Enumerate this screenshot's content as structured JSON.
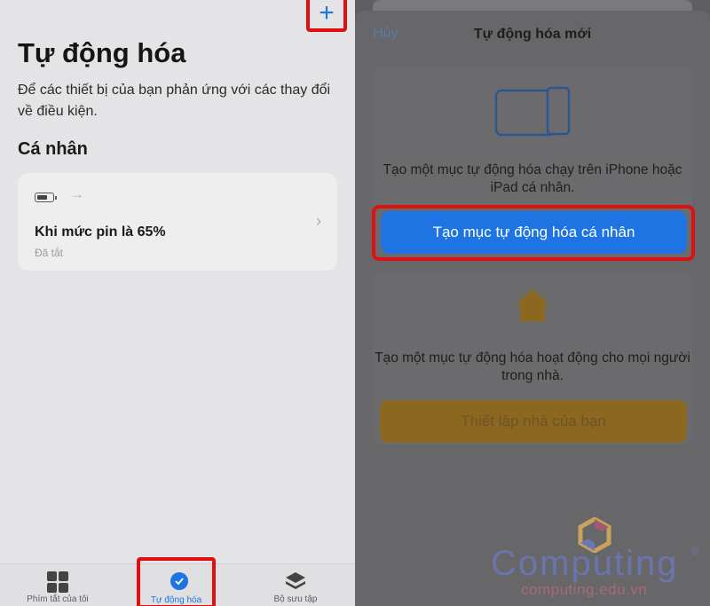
{
  "left": {
    "add_icon": "plus-icon",
    "title": "Tự động hóa",
    "description": "Để các thiết bị của bạn phản ứng với các thay đổi về điều kiện.",
    "section": "Cá nhân",
    "card": {
      "title": "Khi mức pin là 65%",
      "status": "Đã tắt"
    },
    "tabs": [
      {
        "label": "Phím tắt của tôi",
        "icon": "grid-icon"
      },
      {
        "label": "Tự động hóa",
        "icon": "automation-clock-icon",
        "active": true
      },
      {
        "label": "Bộ sưu tập",
        "icon": "gallery-layers-icon"
      }
    ]
  },
  "right": {
    "cancel": "Hủy",
    "title": "Tự động hóa mới",
    "personal_text": "Tạo một mục tự động hóa chạy trên iPhone hoặc iPad cá nhân.",
    "personal_button": "Tạo mục tự động hóa cá nhân",
    "home_text": "Tạo một mục tự động hóa hoạt động cho mọi người trong nhà.",
    "home_button": "Thiết lập nhà của bạn"
  },
  "watermark": {
    "brand": "Computing",
    "reg": "®",
    "url": "computing.edu.vn"
  },
  "colors": {
    "accent": "#1e74e3",
    "highlight": "#e01010",
    "home_orange": "#8b6720"
  }
}
